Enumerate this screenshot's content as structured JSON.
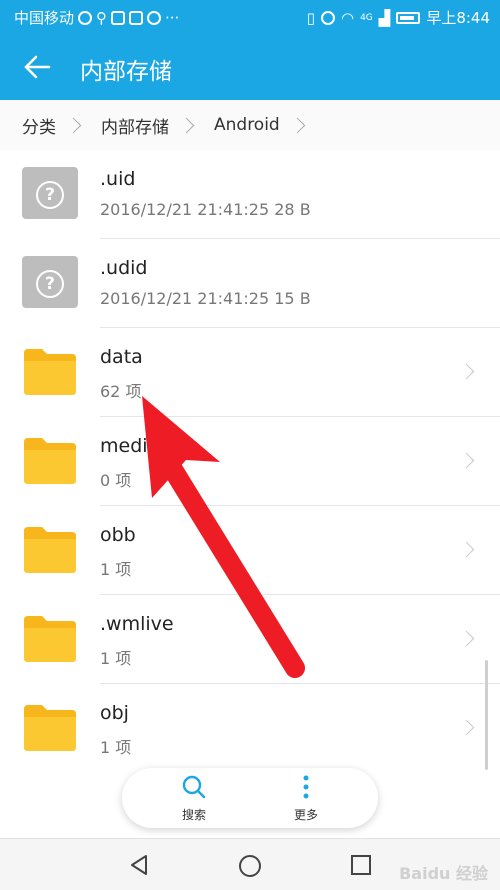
{
  "statusbar": {
    "carrier": "中国移动",
    "network": "4G",
    "time": "早上8:44"
  },
  "header": {
    "title": "内部存储"
  },
  "breadcrumb": [
    {
      "label": "分类"
    },
    {
      "label": "内部存储"
    },
    {
      "label": "Android"
    }
  ],
  "files": [
    {
      "name": ".uid",
      "meta": "2016/12/21 21:41:25 28 B",
      "type": "file"
    },
    {
      "name": ".udid",
      "meta": "2016/12/21 21:41:25 15 B",
      "type": "file"
    },
    {
      "name": "data",
      "meta": "62 项",
      "type": "folder"
    },
    {
      "name": "media",
      "meta": "0 项",
      "type": "folder"
    },
    {
      "name": "obb",
      "meta": "1 项",
      "type": "folder"
    },
    {
      "name": ".wmlive",
      "meta": "1 项",
      "type": "folder"
    },
    {
      "name": "obj",
      "meta": "1 项",
      "type": "folder"
    }
  ],
  "toolbar": {
    "search_label": "搜索",
    "more_label": "更多"
  },
  "colors": {
    "accent": "#1aa7e4",
    "folder": "#fbc02d",
    "arrow": "#ee1c25"
  },
  "watermark": "Baidu 经验"
}
